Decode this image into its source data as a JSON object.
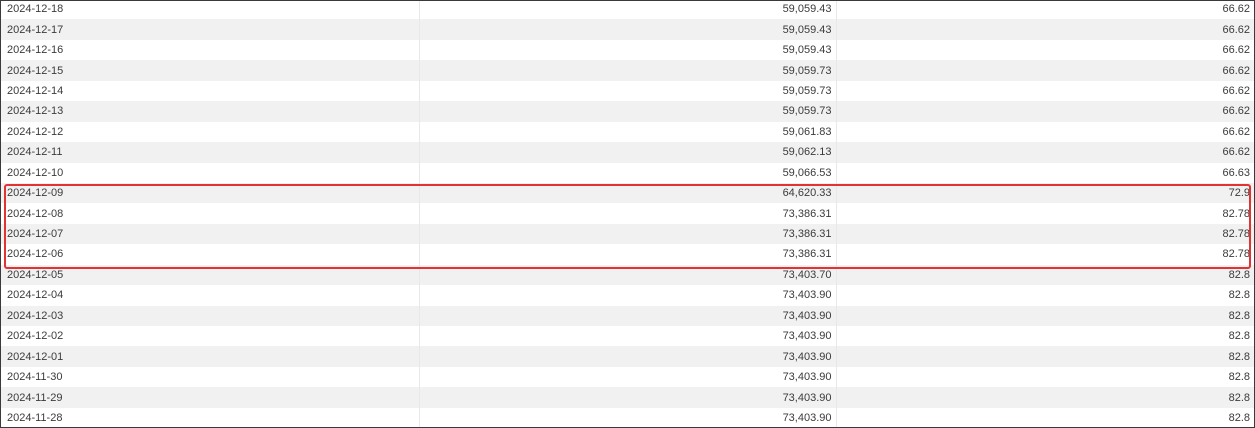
{
  "table": {
    "rows": [
      {
        "date": "2024-12-18",
        "value": "59,059.43",
        "ratio": "66.62"
      },
      {
        "date": "2024-12-17",
        "value": "59,059.43",
        "ratio": "66.62"
      },
      {
        "date": "2024-12-16",
        "value": "59,059.43",
        "ratio": "66.62"
      },
      {
        "date": "2024-12-15",
        "value": "59,059.73",
        "ratio": "66.62"
      },
      {
        "date": "2024-12-14",
        "value": "59,059.73",
        "ratio": "66.62"
      },
      {
        "date": "2024-12-13",
        "value": "59,059.73",
        "ratio": "66.62"
      },
      {
        "date": "2024-12-12",
        "value": "59,061.83",
        "ratio": "66.62"
      },
      {
        "date": "2024-12-11",
        "value": "59,062.13",
        "ratio": "66.62"
      },
      {
        "date": "2024-12-10",
        "value": "59,066.53",
        "ratio": "66.63"
      },
      {
        "date": "2024-12-09",
        "value": "64,620.33",
        "ratio": "72.9"
      },
      {
        "date": "2024-12-08",
        "value": "73,386.31",
        "ratio": "82.78"
      },
      {
        "date": "2024-12-07",
        "value": "73,386.31",
        "ratio": "82.78"
      },
      {
        "date": "2024-12-06",
        "value": "73,386.31",
        "ratio": "82.78"
      },
      {
        "date": "2024-12-05",
        "value": "73,403.70",
        "ratio": "82.8"
      },
      {
        "date": "2024-12-04",
        "value": "73,403.90",
        "ratio": "82.8"
      },
      {
        "date": "2024-12-03",
        "value": "73,403.90",
        "ratio": "82.8"
      },
      {
        "date": "2024-12-02",
        "value": "73,403.90",
        "ratio": "82.8"
      },
      {
        "date": "2024-12-01",
        "value": "73,403.90",
        "ratio": "82.8"
      },
      {
        "date": "2024-11-30",
        "value": "73,403.90",
        "ratio": "82.8"
      },
      {
        "date": "2024-11-29",
        "value": "73,403.90",
        "ratio": "82.8"
      },
      {
        "date": "2024-11-28",
        "value": "73,403.90",
        "ratio": "82.8"
      }
    ]
  },
  "highlight": {
    "color": "#e03333"
  }
}
